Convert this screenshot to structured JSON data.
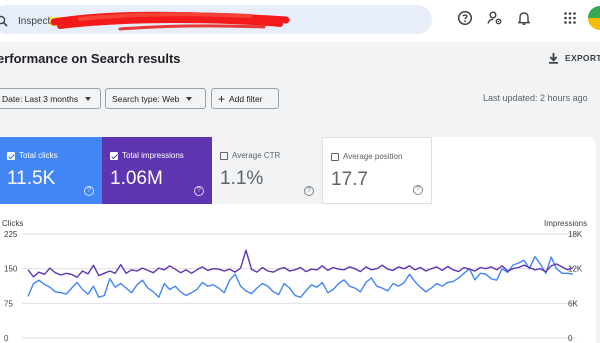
{
  "search": {
    "text": "Inspect any URL in"
  },
  "icons": [
    "search-icon",
    "help-icon",
    "account-settings-icon",
    "bell-icon",
    "apps-grid-icon",
    "avatar"
  ],
  "page": {
    "title": "erformance on Search results"
  },
  "export": {
    "label": "EXPORT"
  },
  "filters": [
    {
      "label": "Date: Last 3 months"
    },
    {
      "label": "Search type: Web"
    },
    {
      "label": "Add filter"
    }
  ],
  "last_updated": "Last updated: 2 hours ago",
  "metrics": [
    {
      "label": "Total clicks",
      "value": "11.5K",
      "checked": true,
      "color": "#4285f4"
    },
    {
      "label": "Total impressions",
      "value": "1.06M",
      "checked": true,
      "color": "#5e35b1"
    },
    {
      "label": "Average CTR",
      "value": "1.1%",
      "checked": false
    },
    {
      "label": "Average position",
      "value": "17.7",
      "checked": false
    }
  ],
  "chart_data": {
    "type": "line",
    "left_axis_title": "Clicks",
    "right_axis_title": "Impressions",
    "left_ticks": [
      "225",
      "150",
      "75",
      "0"
    ],
    "right_ticks": [
      "18K",
      "12K",
      "6K",
      "0"
    ],
    "ylim_left": [
      0,
      225
    ],
    "ylim_right": [
      0,
      18000
    ],
    "grid": true,
    "series": [
      {
        "name": "Clicks",
        "axis": "left",
        "color": "#4285f4",
        "values": [
          90,
          118,
          125,
          116,
          110,
          100,
          98,
          95,
          108,
          120,
          105,
          95,
          112,
          88,
          92,
          128,
          110,
          118,
          108,
          98,
          115,
          125,
          108,
          100,
          88,
          118,
          105,
          112,
          100,
          92,
          98,
          105,
          120,
          112,
          115,
          108,
          98,
          125,
          138,
          112,
          102,
          96,
          108,
          118,
          112,
          100,
          94,
          118,
          108,
          92,
          88,
          102,
          115,
          110,
          120,
          98,
          105,
          118,
          126,
          112,
          108,
          100,
          120,
          130,
          112,
          108,
          102,
          118,
          112,
          120,
          138,
          122,
          110,
          100,
          108,
          118,
          112,
          120,
          122,
          130,
          140,
          150,
          126,
          140,
          138,
          128,
          125,
          150,
          142,
          158,
          162,
          168,
          150,
          176,
          160,
          140,
          175,
          150,
          140,
          140,
          138
        ]
      },
      {
        "name": "Impressions",
        "axis": "right",
        "color": "#5e35b1",
        "values": [
          11800,
          10600,
          11400,
          11000,
          12100,
          11300,
          10900,
          11200,
          11000,
          10500,
          11600,
          11100,
          12600,
          10800,
          11200,
          11600,
          11200,
          12700,
          11200,
          11800,
          11600,
          12100,
          11700,
          11300,
          12100,
          11800,
          12500,
          11900,
          11300,
          11800,
          11200,
          11800,
          12300,
          11700,
          12000,
          11900,
          11600,
          11900,
          11400,
          12100,
          15200,
          11900,
          11400,
          12200,
          11600,
          11400,
          11900,
          12200,
          11600,
          11800,
          12200,
          11500,
          11900,
          11800,
          12500,
          11700,
          12200,
          11900,
          11800,
          12300,
          12000,
          11500,
          12300,
          11800,
          12000,
          12600,
          11900,
          11700,
          12300,
          12000,
          12500,
          11800,
          12200,
          11600,
          12000,
          12300,
          11700,
          12400,
          11800,
          11500,
          12200,
          11900,
          11600,
          12200,
          12000,
          12300,
          11800,
          12500,
          11600,
          12000,
          12200,
          12600,
          12200,
          11800,
          12000,
          11500,
          12500,
          12800,
          12300,
          11800,
          12200
        ]
      }
    ]
  }
}
